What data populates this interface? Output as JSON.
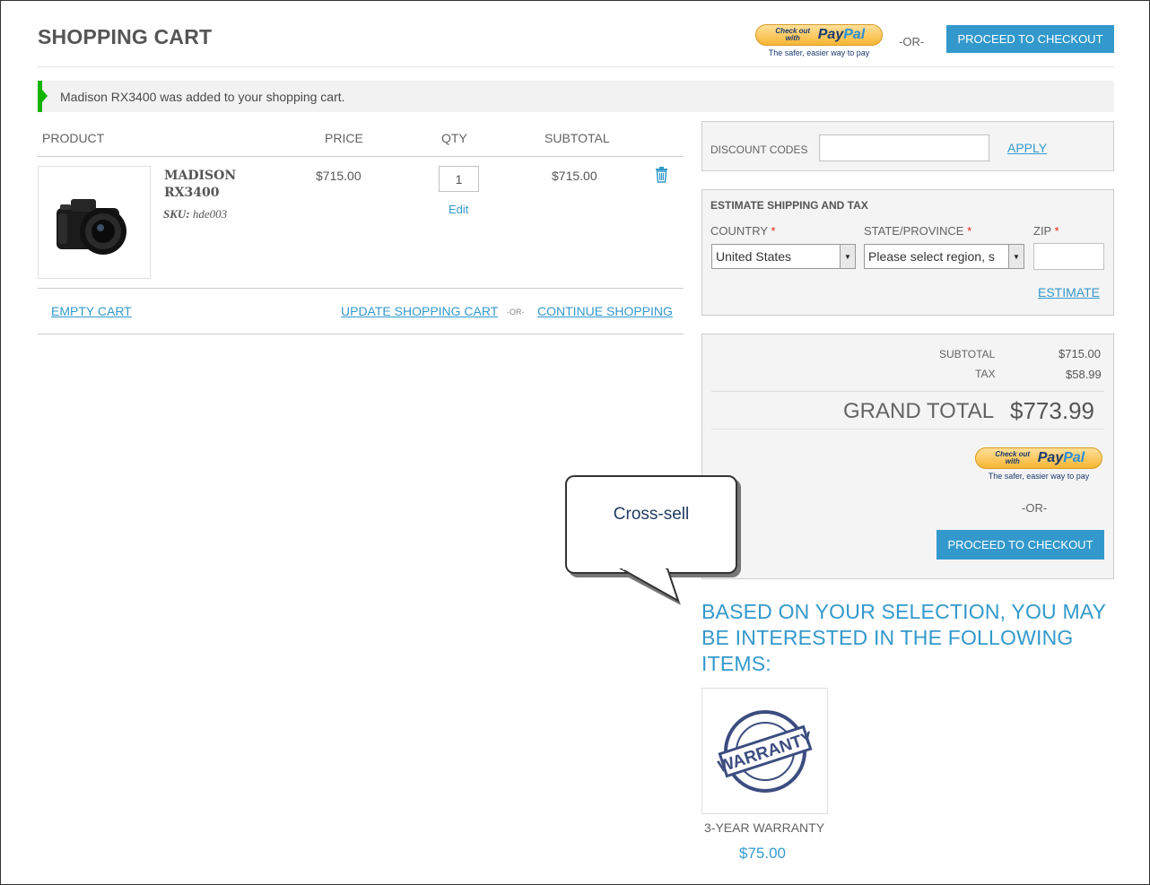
{
  "header": {
    "title": "SHOPPING CART",
    "paypal_small": "Check out with",
    "paypal_logo_pay": "Pay",
    "paypal_logo_pal": "Pal",
    "paypal_tagline": "The safer, easier way to pay",
    "or_text": "-OR-",
    "checkout_label": "PROCEED TO CHECKOUT"
  },
  "message": "Madison RX3400 was added to your shopping cart.",
  "cart": {
    "columns": {
      "product": "PRODUCT",
      "price": "PRICE",
      "qty": "QTY",
      "subtotal": "SUBTOTAL"
    },
    "item": {
      "name": "MADISON RX3400",
      "sku_label": "SKU:",
      "sku": "hde003",
      "price": "$715.00",
      "qty": "1",
      "edit_label": "Edit",
      "subtotal": "$715.00",
      "image_icon": "camera-icon",
      "delete_icon": "trash-icon"
    },
    "actions": {
      "empty": "EMPTY CART",
      "update": "UPDATE SHOPPING CART",
      "or": "-OR-",
      "continue": "CONTINUE SHOPPING"
    }
  },
  "discount": {
    "label": "DISCOUNT CODES",
    "value": "",
    "apply": "APPLY"
  },
  "shipping": {
    "title": "ESTIMATE SHIPPING AND TAX",
    "country_label": "COUNTRY",
    "state_label": "STATE/PROVINCE",
    "zip_label": "ZIP",
    "required_mark": "*",
    "country_value": "United States",
    "state_value": "Please select region, s",
    "zip_value": "",
    "estimate": "ESTIMATE"
  },
  "totals": {
    "subtotal_label": "SUBTOTAL",
    "subtotal": "$715.00",
    "tax_label": "TAX",
    "tax": "$58.99",
    "grand_label": "GRAND TOTAL",
    "grand": "$773.99",
    "or_text": "-OR-",
    "checkout_label": "PROCEED TO CHECKOUT"
  },
  "callout": {
    "text": "Cross-sell"
  },
  "crosssell": {
    "heading": "BASED ON YOUR SELECTION, YOU MAY BE INTERESTED IN THE FOLLOWING ITEMS:",
    "item": {
      "name": "3-YEAR WARRANTY",
      "price": "$75.00",
      "image_icon": "warranty-stamp-icon",
      "stamp_text": "WARRANTY"
    }
  },
  "colors": {
    "accent": "#3399cc",
    "success": "#11b400",
    "required": "#df280a",
    "panel": "#f4f4f4"
  }
}
